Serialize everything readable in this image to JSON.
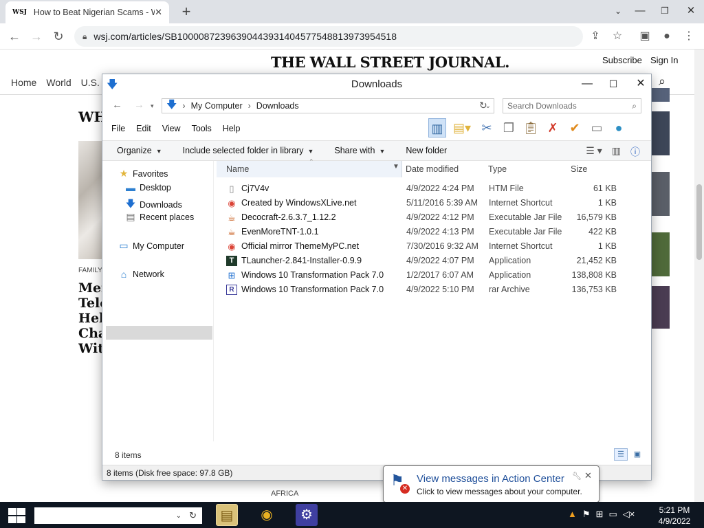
{
  "browser": {
    "tab_title": "How to Beat Nigerian Scams - W",
    "tab_favicon": "WSJ",
    "url": "wsj.com/articles/SB10000872396390443931404577548813973954518"
  },
  "wsj": {
    "masthead": "THE WALL STREET JOURNAL.",
    "subscribe": "Subscribe",
    "sign_in": "Sign In",
    "nav": [
      "Home",
      "World",
      "U.S."
    ],
    "section_heading": "WHA",
    "category": "FAMILY",
    "headline_lines": [
      "Mer",
      "Tele",
      "Hel",
      "Cha",
      "Wit"
    ],
    "bottom_label": "AFRICA"
  },
  "explorer": {
    "title": "Downloads",
    "breadcrumb": [
      "My Computer",
      "Downloads"
    ],
    "search_placeholder": "Search Downloads",
    "menu": [
      "File",
      "Edit",
      "View",
      "Tools",
      "Help"
    ],
    "commands": {
      "organize": "Organize",
      "include": "Include selected folder in library",
      "share": "Share with",
      "new_folder": "New folder"
    },
    "nav_pane": {
      "favorites": "Favorites",
      "desktop": "Desktop",
      "downloads": "Downloads",
      "recent": "Recent places",
      "my_computer": "My Computer",
      "network": "Network"
    },
    "columns": {
      "name": "Name",
      "date": "Date modified",
      "type": "Type",
      "size": "Size"
    },
    "files": [
      {
        "name": "Cj7V4v",
        "date": "4/9/2022 4:24 PM",
        "type": "HTM File",
        "size": "61 KB",
        "icon": "htm-file-icon"
      },
      {
        "name": "Created by WindowsXLive.net",
        "date": "5/11/2016 5:39 AM",
        "type": "Internet Shortcut",
        "size": "1 KB",
        "icon": "chrome-shortcut-icon"
      },
      {
        "name": "Decocraft-2.6.3.7_1.12.2",
        "date": "4/9/2022 4:12 PM",
        "type": "Executable Jar File",
        "size": "16,579 KB",
        "icon": "java-jar-icon"
      },
      {
        "name": "EvenMoreTNT-1.0.1",
        "date": "4/9/2022 4:13 PM",
        "type": "Executable Jar File",
        "size": "422 KB",
        "icon": "java-jar-icon"
      },
      {
        "name": "Official mirror ThemeMyPC.net",
        "date": "7/30/2016 9:32 AM",
        "type": "Internet Shortcut",
        "size": "1 KB",
        "icon": "chrome-shortcut-icon"
      },
      {
        "name": "TLauncher-2.841-Installer-0.9.9",
        "date": "4/9/2022 4:07 PM",
        "type": "Application",
        "size": "21,452 KB",
        "icon": "tlauncher-icon"
      },
      {
        "name": "Windows 10 Transformation Pack 7.0",
        "date": "1/2/2017 6:07 AM",
        "type": "Application",
        "size": "138,808 KB",
        "icon": "windows-app-icon"
      },
      {
        "name": "Windows 10 Transformation Pack 7.0",
        "date": "4/9/2022 5:10 PM",
        "type": "rar Archive",
        "size": "136,753 KB",
        "icon": "rar-archive-icon"
      }
    ],
    "item_count": "8 items",
    "status": "8 items (Disk free space: 97.8 GB)"
  },
  "notification": {
    "title": "View messages in Action Center",
    "subtitle": "Click to view messages about your computer."
  },
  "taskbar": {
    "time": "5:21 PM",
    "date": "4/9/2022"
  }
}
